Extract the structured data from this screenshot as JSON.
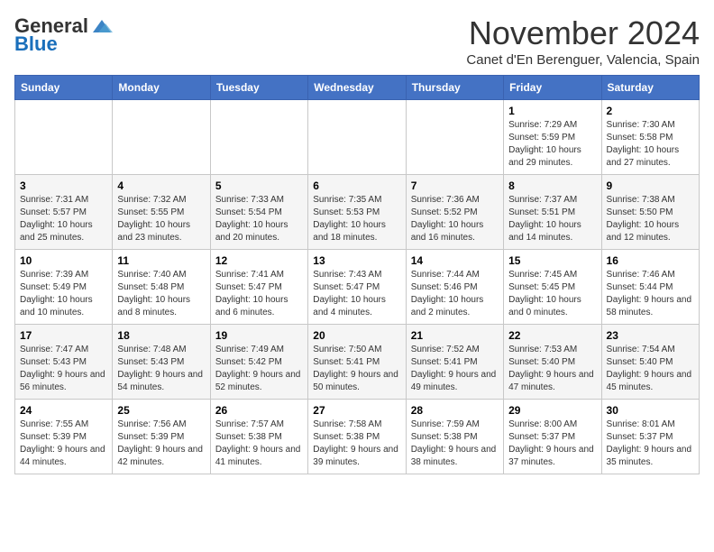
{
  "header": {
    "logo_general": "General",
    "logo_blue": "Blue",
    "month_title": "November 2024",
    "location": "Canet d'En Berenguer, Valencia, Spain"
  },
  "weekdays": [
    "Sunday",
    "Monday",
    "Tuesday",
    "Wednesday",
    "Thursday",
    "Friday",
    "Saturday"
  ],
  "weeks": [
    [
      {
        "day": "",
        "sunrise": "",
        "sunset": "",
        "daylight": ""
      },
      {
        "day": "",
        "sunrise": "",
        "sunset": "",
        "daylight": ""
      },
      {
        "day": "",
        "sunrise": "",
        "sunset": "",
        "daylight": ""
      },
      {
        "day": "",
        "sunrise": "",
        "sunset": "",
        "daylight": ""
      },
      {
        "day": "",
        "sunrise": "",
        "sunset": "",
        "daylight": ""
      },
      {
        "day": "1",
        "sunrise": "Sunrise: 7:29 AM",
        "sunset": "Sunset: 5:59 PM",
        "daylight": "Daylight: 10 hours and 29 minutes."
      },
      {
        "day": "2",
        "sunrise": "Sunrise: 7:30 AM",
        "sunset": "Sunset: 5:58 PM",
        "daylight": "Daylight: 10 hours and 27 minutes."
      }
    ],
    [
      {
        "day": "3",
        "sunrise": "Sunrise: 7:31 AM",
        "sunset": "Sunset: 5:57 PM",
        "daylight": "Daylight: 10 hours and 25 minutes."
      },
      {
        "day": "4",
        "sunrise": "Sunrise: 7:32 AM",
        "sunset": "Sunset: 5:55 PM",
        "daylight": "Daylight: 10 hours and 23 minutes."
      },
      {
        "day": "5",
        "sunrise": "Sunrise: 7:33 AM",
        "sunset": "Sunset: 5:54 PM",
        "daylight": "Daylight: 10 hours and 20 minutes."
      },
      {
        "day": "6",
        "sunrise": "Sunrise: 7:35 AM",
        "sunset": "Sunset: 5:53 PM",
        "daylight": "Daylight: 10 hours and 18 minutes."
      },
      {
        "day": "7",
        "sunrise": "Sunrise: 7:36 AM",
        "sunset": "Sunset: 5:52 PM",
        "daylight": "Daylight: 10 hours and 16 minutes."
      },
      {
        "day": "8",
        "sunrise": "Sunrise: 7:37 AM",
        "sunset": "Sunset: 5:51 PM",
        "daylight": "Daylight: 10 hours and 14 minutes."
      },
      {
        "day": "9",
        "sunrise": "Sunrise: 7:38 AM",
        "sunset": "Sunset: 5:50 PM",
        "daylight": "Daylight: 10 hours and 12 minutes."
      }
    ],
    [
      {
        "day": "10",
        "sunrise": "Sunrise: 7:39 AM",
        "sunset": "Sunset: 5:49 PM",
        "daylight": "Daylight: 10 hours and 10 minutes."
      },
      {
        "day": "11",
        "sunrise": "Sunrise: 7:40 AM",
        "sunset": "Sunset: 5:48 PM",
        "daylight": "Daylight: 10 hours and 8 minutes."
      },
      {
        "day": "12",
        "sunrise": "Sunrise: 7:41 AM",
        "sunset": "Sunset: 5:47 PM",
        "daylight": "Daylight: 10 hours and 6 minutes."
      },
      {
        "day": "13",
        "sunrise": "Sunrise: 7:43 AM",
        "sunset": "Sunset: 5:47 PM",
        "daylight": "Daylight: 10 hours and 4 minutes."
      },
      {
        "day": "14",
        "sunrise": "Sunrise: 7:44 AM",
        "sunset": "Sunset: 5:46 PM",
        "daylight": "Daylight: 10 hours and 2 minutes."
      },
      {
        "day": "15",
        "sunrise": "Sunrise: 7:45 AM",
        "sunset": "Sunset: 5:45 PM",
        "daylight": "Daylight: 10 hours and 0 minutes."
      },
      {
        "day": "16",
        "sunrise": "Sunrise: 7:46 AM",
        "sunset": "Sunset: 5:44 PM",
        "daylight": "Daylight: 9 hours and 58 minutes."
      }
    ],
    [
      {
        "day": "17",
        "sunrise": "Sunrise: 7:47 AM",
        "sunset": "Sunset: 5:43 PM",
        "daylight": "Daylight: 9 hours and 56 minutes."
      },
      {
        "day": "18",
        "sunrise": "Sunrise: 7:48 AM",
        "sunset": "Sunset: 5:43 PM",
        "daylight": "Daylight: 9 hours and 54 minutes."
      },
      {
        "day": "19",
        "sunrise": "Sunrise: 7:49 AM",
        "sunset": "Sunset: 5:42 PM",
        "daylight": "Daylight: 9 hours and 52 minutes."
      },
      {
        "day": "20",
        "sunrise": "Sunrise: 7:50 AM",
        "sunset": "Sunset: 5:41 PM",
        "daylight": "Daylight: 9 hours and 50 minutes."
      },
      {
        "day": "21",
        "sunrise": "Sunrise: 7:52 AM",
        "sunset": "Sunset: 5:41 PM",
        "daylight": "Daylight: 9 hours and 49 minutes."
      },
      {
        "day": "22",
        "sunrise": "Sunrise: 7:53 AM",
        "sunset": "Sunset: 5:40 PM",
        "daylight": "Daylight: 9 hours and 47 minutes."
      },
      {
        "day": "23",
        "sunrise": "Sunrise: 7:54 AM",
        "sunset": "Sunset: 5:40 PM",
        "daylight": "Daylight: 9 hours and 45 minutes."
      }
    ],
    [
      {
        "day": "24",
        "sunrise": "Sunrise: 7:55 AM",
        "sunset": "Sunset: 5:39 PM",
        "daylight": "Daylight: 9 hours and 44 minutes."
      },
      {
        "day": "25",
        "sunrise": "Sunrise: 7:56 AM",
        "sunset": "Sunset: 5:39 PM",
        "daylight": "Daylight: 9 hours and 42 minutes."
      },
      {
        "day": "26",
        "sunrise": "Sunrise: 7:57 AM",
        "sunset": "Sunset: 5:38 PM",
        "daylight": "Daylight: 9 hours and 41 minutes."
      },
      {
        "day": "27",
        "sunrise": "Sunrise: 7:58 AM",
        "sunset": "Sunset: 5:38 PM",
        "daylight": "Daylight: 9 hours and 39 minutes."
      },
      {
        "day": "28",
        "sunrise": "Sunrise: 7:59 AM",
        "sunset": "Sunset: 5:38 PM",
        "daylight": "Daylight: 9 hours and 38 minutes."
      },
      {
        "day": "29",
        "sunrise": "Sunrise: 8:00 AM",
        "sunset": "Sunset: 5:37 PM",
        "daylight": "Daylight: 9 hours and 37 minutes."
      },
      {
        "day": "30",
        "sunrise": "Sunrise: 8:01 AM",
        "sunset": "Sunset: 5:37 PM",
        "daylight": "Daylight: 9 hours and 35 minutes."
      }
    ]
  ]
}
